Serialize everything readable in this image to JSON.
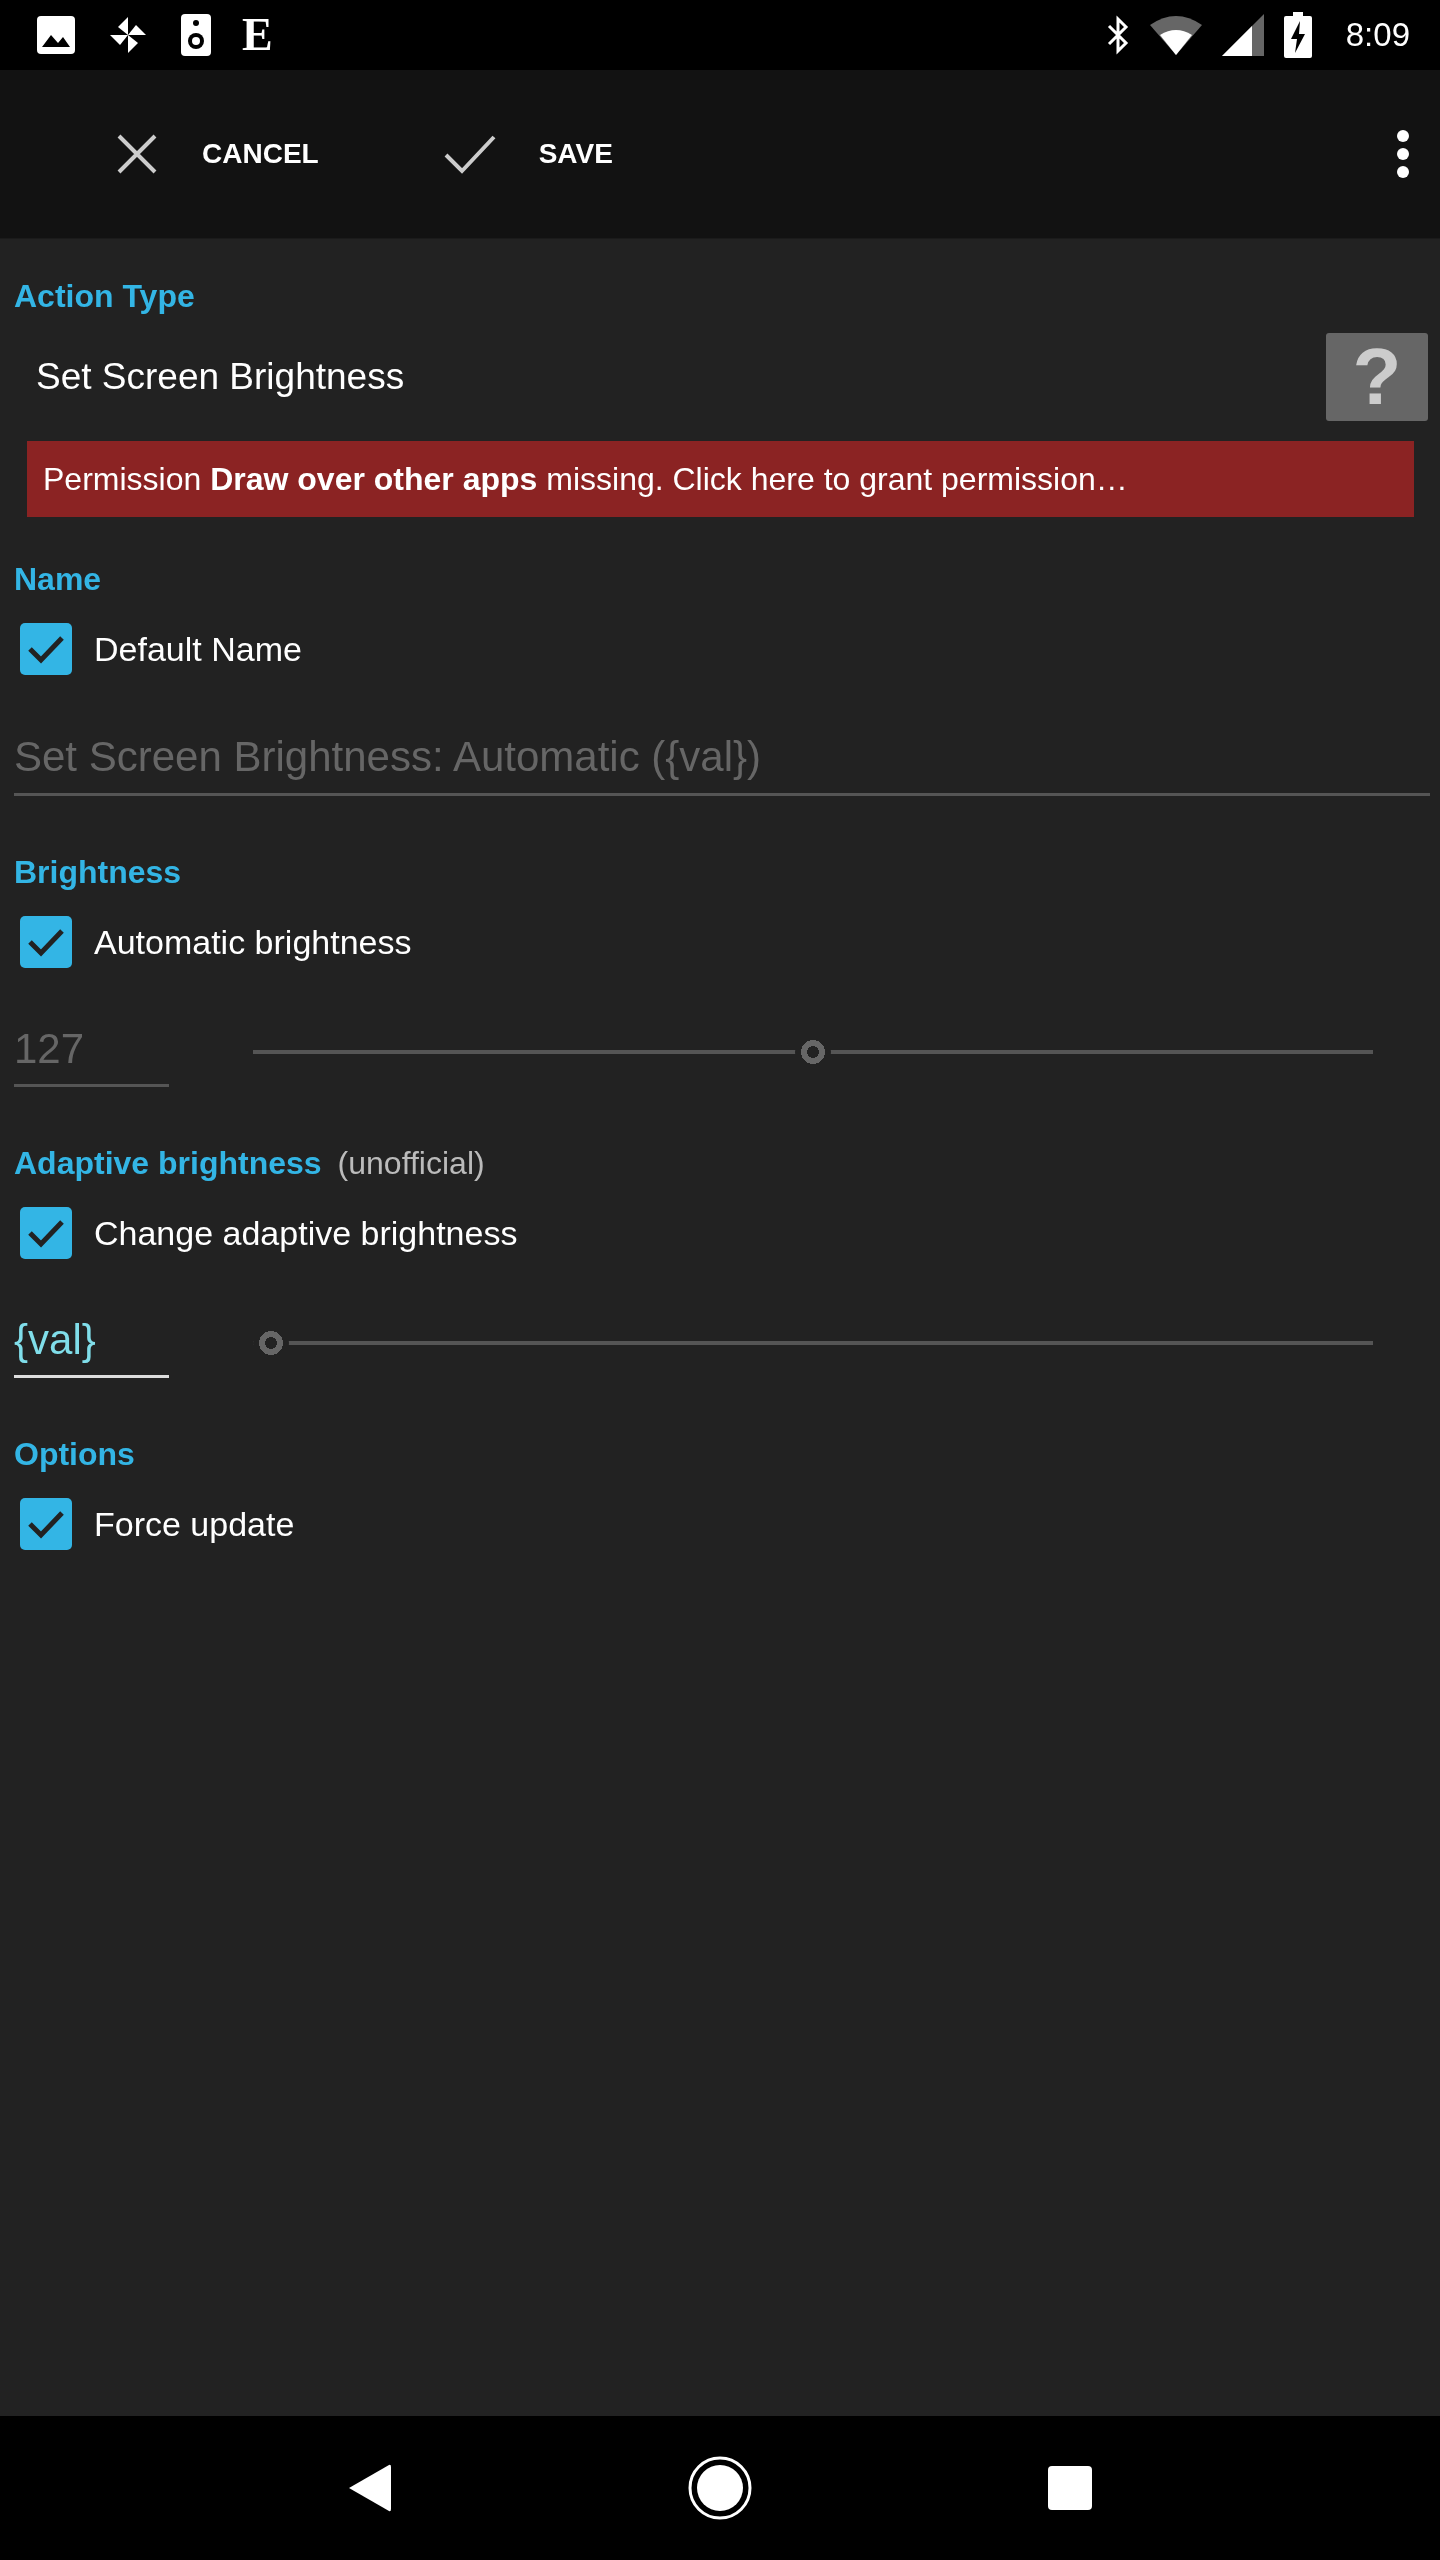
{
  "status_bar": {
    "notification_glyph": "E",
    "time": "8:09"
  },
  "toolbar": {
    "cancel": "CANCEL",
    "save": "SAVE"
  },
  "sections": [
    {
      "title": "Action Type",
      "items": [
        {
          "kind": "action",
          "label": "Set Screen Brightness",
          "help": "?"
        },
        {
          "kind": "warning",
          "text": "Permission **Draw over other apps** missing. Click here to grant permission…"
        }
      ]
    },
    {
      "title": "Name",
      "items": [
        {
          "kind": "checkbox",
          "label": "Default Name",
          "checked": true
        },
        {
          "kind": "text_field",
          "placeholder": "Set Screen Brightness: Automatic ({val})"
        }
      ]
    },
    {
      "title": "Brightness",
      "items": [
        {
          "kind": "checkbox",
          "label": "Automatic brightness",
          "checked": true
        },
        {
          "kind": "slider",
          "value": "127",
          "disabled": true,
          "level": 0.5
        }
      ]
    },
    {
      "title": "Adaptive brightness",
      "note": "(unofficial)",
      "items": [
        {
          "kind": "checkbox",
          "label": "Change adaptive brightness",
          "checked": true
        },
        {
          "kind": "slider",
          "value": "{val}",
          "disabled": false,
          "level": 0
        }
      ]
    },
    {
      "title": "Options",
      "items": [
        {
          "kind": "checkbox",
          "label": "Force update",
          "checked": true
        }
      ]
    }
  ]
}
